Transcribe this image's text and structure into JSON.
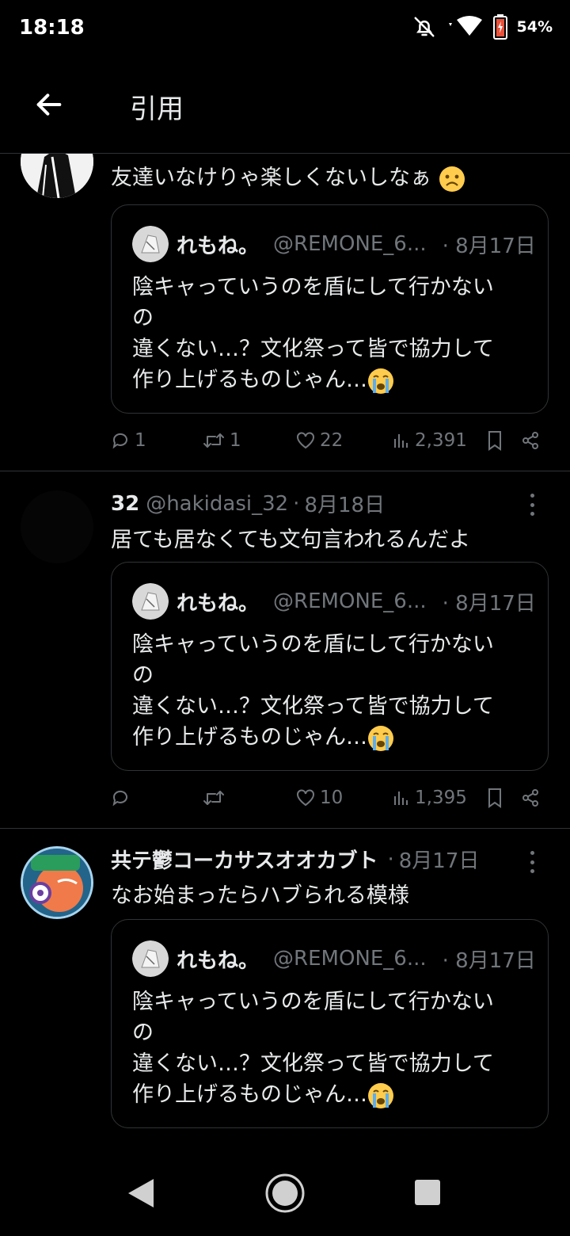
{
  "status_bar": {
    "time": "18:18",
    "battery": "54%"
  },
  "header": {
    "title": "引用"
  },
  "quoted_tweet": {
    "name": "れもね。",
    "handle": "@REMONE_6...",
    "dot": "·",
    "date": "8月17日",
    "lines": [
      "陰キャっていうのを盾にして行かない",
      "の",
      "違くない…？文化祭って皆で協力して",
      "作り上げるものじゃん…"
    ]
  },
  "tweets": [
    {
      "name": "",
      "handle": "",
      "dot": "",
      "date": "",
      "text": "友達いなけりゃ楽しくないしなぁ",
      "replies": "1",
      "retweets": "1",
      "likes": "22",
      "views": "2,391"
    },
    {
      "name": "32",
      "handle": "@hakidasi_32",
      "dot": "·",
      "date": "8月18日",
      "text": "居ても居なくても文句言われるんだよ",
      "replies": "",
      "retweets": "",
      "likes": "10",
      "views": "1,395"
    },
    {
      "name": "共テ鬱コーカサスオオカブト",
      "handle": "",
      "dot": "·",
      "date": "8月17日",
      "text": "なお始まったらハブられる模様",
      "replies": "",
      "retweets": "",
      "likes": "",
      "views": ""
    }
  ],
  "colors": {
    "background": "#000000",
    "text": "#e7e9ea",
    "muted": "#71767b",
    "border": "#2f3336"
  },
  "icons": [
    "back-arrow-icon",
    "bell-off-icon",
    "wifi-icon",
    "battery-icon",
    "more-icon",
    "reply-icon",
    "retweet-icon",
    "like-icon",
    "views-icon",
    "bookmark-icon",
    "share-icon",
    "nav-back-icon",
    "nav-home-icon",
    "nav-recents-icon"
  ]
}
